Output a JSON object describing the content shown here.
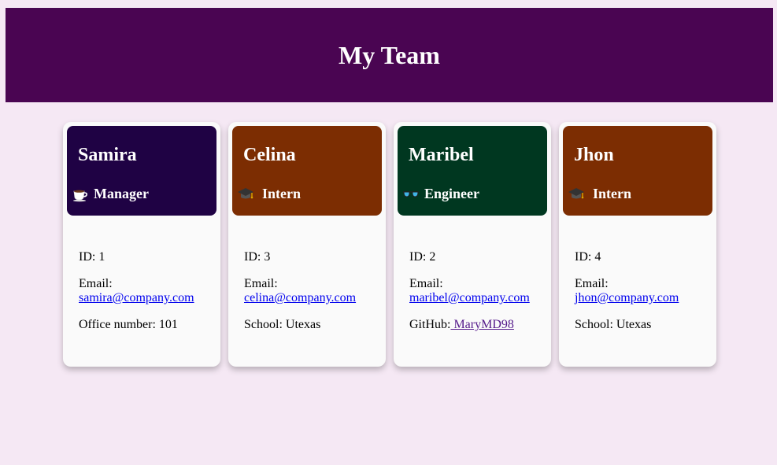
{
  "header": {
    "title": "My Team"
  },
  "cards": [
    {
      "name": "Samira",
      "role": "Manager",
      "icon": "coffee-cup-icon",
      "head_color": "#1f0244",
      "id_label": "ID: 1",
      "email_label": "Email:",
      "email": "samira@company.com",
      "extra_label": "Office number: 101"
    },
    {
      "name": "Celina",
      "role": "Intern",
      "icon": "graduation-cap-icon",
      "head_color": "#7c2d02",
      "id_label": "ID: 3",
      "email_label": "Email:",
      "email": "celina@company.com",
      "extra_label": "School: Utexas"
    },
    {
      "name": "Maribel",
      "role": "Engineer",
      "icon": "glasses-icon",
      "head_color": "#003720",
      "id_label": "ID: 2",
      "email_label": "Email:",
      "email": "maribel@company.com",
      "github_label": "GitHub:",
      "github": " MaryMD98"
    },
    {
      "name": "Jhon",
      "role": "Intern",
      "icon": "graduation-cap-icon",
      "head_color": "#7c2d02",
      "id_label": "ID: 4",
      "email_label": "Email:",
      "email": "jhon@company.com",
      "extra_label": "School: Utexas"
    }
  ]
}
